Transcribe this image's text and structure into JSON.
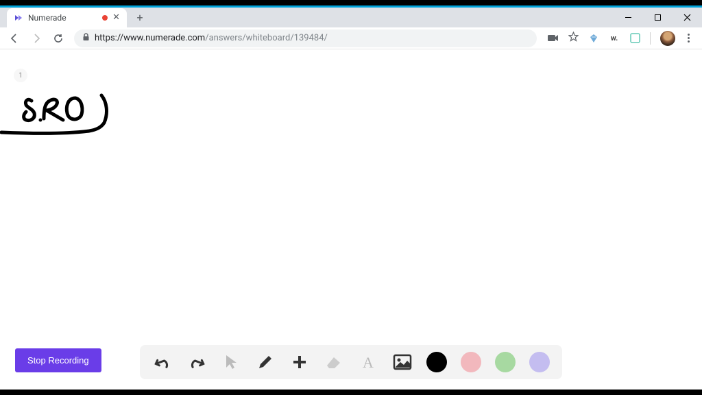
{
  "browser": {
    "tab_title": "Numerade",
    "url_domain": "https://www.numerade.com",
    "url_path": "/answers/whiteboard/139484/",
    "extensions": {
      "w_label": "w."
    }
  },
  "page": {
    "page_number": "1",
    "handwriting_value": "8,20",
    "stop_recording_label": "Stop Recording"
  },
  "toolbar": {
    "colors": {
      "black": "#000000",
      "pink": "#f2b8bd",
      "green": "#a7d9a1",
      "purple": "#c4bdf0"
    }
  }
}
